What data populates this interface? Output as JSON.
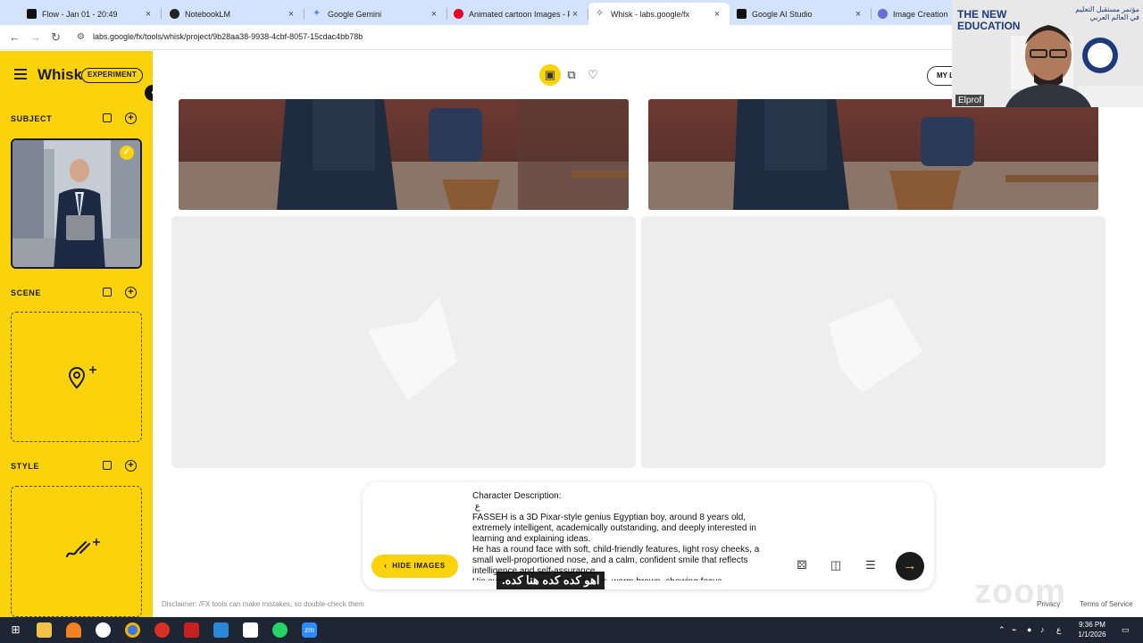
{
  "browser": {
    "tabs": [
      {
        "title": "Flow - Jan 01 - 20:49",
        "favicon_color": "#111111"
      },
      {
        "title": "NotebookLM",
        "favicon_color": "#222222"
      },
      {
        "title": "Google Gemini",
        "favicon_color": "#4f8cf0"
      },
      {
        "title": "Animated cartoon Images - Fre",
        "favicon_color": "#e60023"
      },
      {
        "title": "Whisk - labs.google/fx",
        "favicon_color": "#555555"
      },
      {
        "title": "Google AI Studio",
        "favicon_color": "#111111"
      },
      {
        "title": "Image Creation - Le",
        "favicon_color": "#6b6bd6"
      }
    ],
    "close_glyph": "×",
    "url": "labs.google/fx/tools/whisk/project/9b28aa38-9938-4cbf-8057-15cdac4bb78b"
  },
  "sidebar": {
    "app_title": "Whisk",
    "badge": "EXPERIMENT",
    "sections": [
      {
        "label": "SUBJECT"
      },
      {
        "label": "SCENE"
      },
      {
        "label": "STYLE"
      }
    ]
  },
  "main": {
    "my_button": "MY L",
    "disclaimer": "Disclaimer: /FX tools can make mistakes, so double-check them",
    "privacy": "Privacy",
    "terms": "Terms of Service"
  },
  "prompt": {
    "text": "Character Description:\n ع\nFASSEH is a 3D Pixar-style genius Egyptian boy, around 8 years old, extremely intelligent, academically outstanding, and deeply interested in learning and explaining ideas.\nHe has a round face with soft, child-friendly features, light rosy cheeks, a small well-proportioned nose, and a calm, confident smile that reflects intelligence and self-assurance.\nHis eyes are large and expressive, warm brown, showing focus",
    "hide_button": "HIDE IMAGES"
  },
  "overlay": {
    "caption": "اهو كده كده هنا كده.",
    "brand_line1": "THE NEW",
    "brand_line2": "EDUCATION",
    "arabic_title": "مؤتمر مستقبل التعليم في العالم العربي",
    "presenter": "Elprof",
    "watermark": "zoom"
  },
  "taskbar": {
    "time": "9:36 PM",
    "date": "1/1/2026",
    "lang": "ع"
  },
  "colors": {
    "accent_yellow": "#fbd30d",
    "tab_strip": "#d3e3fd",
    "taskbar": "#1f2633"
  }
}
